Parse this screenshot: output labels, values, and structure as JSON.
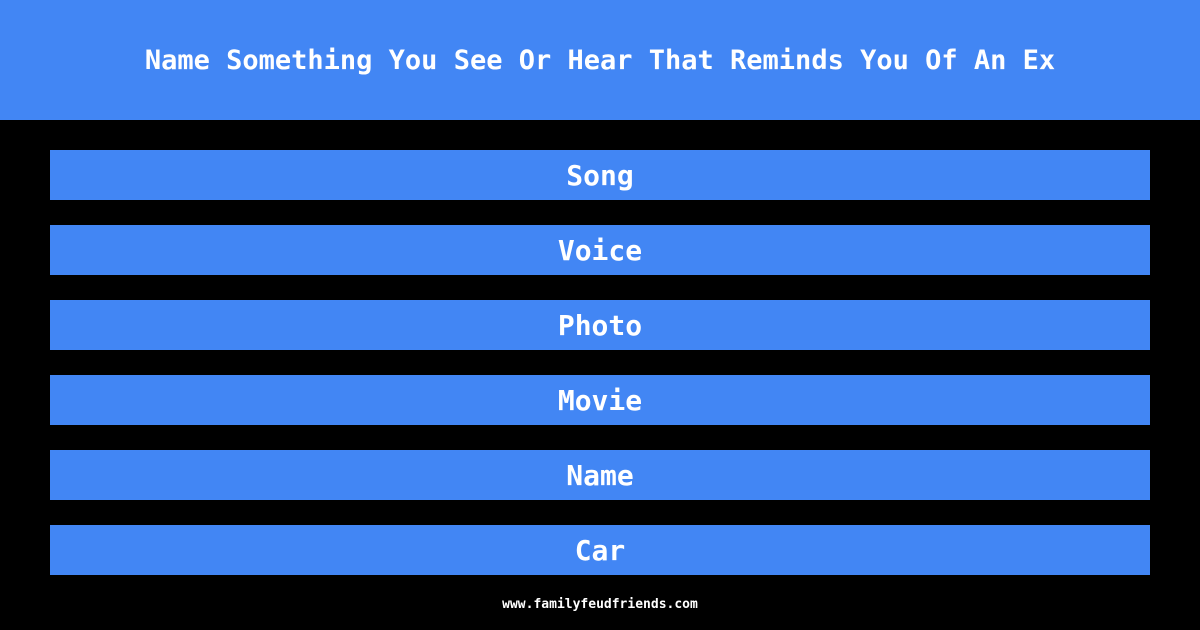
{
  "header": {
    "title": "Name Something You See Or Hear That Reminds You Of An Ex"
  },
  "answers": [
    {
      "label": "Song"
    },
    {
      "label": "Voice"
    },
    {
      "label": "Photo"
    },
    {
      "label": "Movie"
    },
    {
      "label": "Name"
    },
    {
      "label": "Car"
    }
  ],
  "footer": {
    "site": "www.familyfeudfriends.com"
  },
  "colors": {
    "accent": "#4286f4",
    "background": "#000000",
    "text": "#ffffff"
  }
}
